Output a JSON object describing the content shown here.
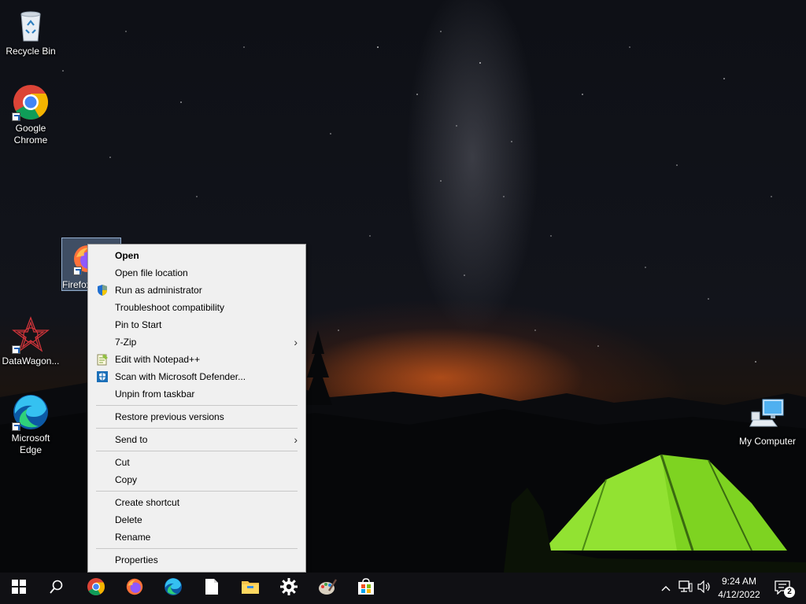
{
  "desktop": {
    "icons": [
      {
        "label": "Recycle Bin"
      },
      {
        "label": "Google\nChrome"
      },
      {
        "label": "Firefox"
      },
      {
        "label": "DataWagon..."
      },
      {
        "label": "Microsoft\nEdge"
      },
      {
        "label": "My Computer"
      }
    ]
  },
  "context_menu": {
    "items": [
      {
        "label": "Open"
      },
      {
        "label": "Open file location"
      },
      {
        "label": "Run as administrator",
        "icon": "shield-icon"
      },
      {
        "label": "Troubleshoot compatibility"
      },
      {
        "label": "Pin to Start"
      },
      {
        "label": "7-Zip",
        "submenu": true
      },
      {
        "label": "Edit with Notepad++",
        "icon": "notepadpp-icon"
      },
      {
        "label": "Scan with Microsoft Defender...",
        "icon": "defender-icon"
      },
      {
        "label": "Unpin from taskbar"
      },
      {
        "label": "Restore previous versions"
      },
      {
        "label": "Send to",
        "submenu": true
      },
      {
        "label": "Cut"
      },
      {
        "label": "Copy"
      },
      {
        "label": "Create shortcut"
      },
      {
        "label": "Delete"
      },
      {
        "label": "Rename"
      },
      {
        "label": "Properties"
      }
    ]
  },
  "taskbar": {
    "apps": [
      "start-icon",
      "search-icon",
      "chrome-icon",
      "firefox-icon",
      "edge-icon",
      "file-icon",
      "file-explorer-icon",
      "settings-icon",
      "paint-icon",
      "store-icon"
    ],
    "clock": {
      "time": "9:24 AM",
      "date": "4/12/2022"
    },
    "notification_count": "2"
  },
  "colors": {
    "taskbar": "#101014",
    "menu_bg": "#f0f0f0",
    "tent_green": "#7ed321"
  }
}
